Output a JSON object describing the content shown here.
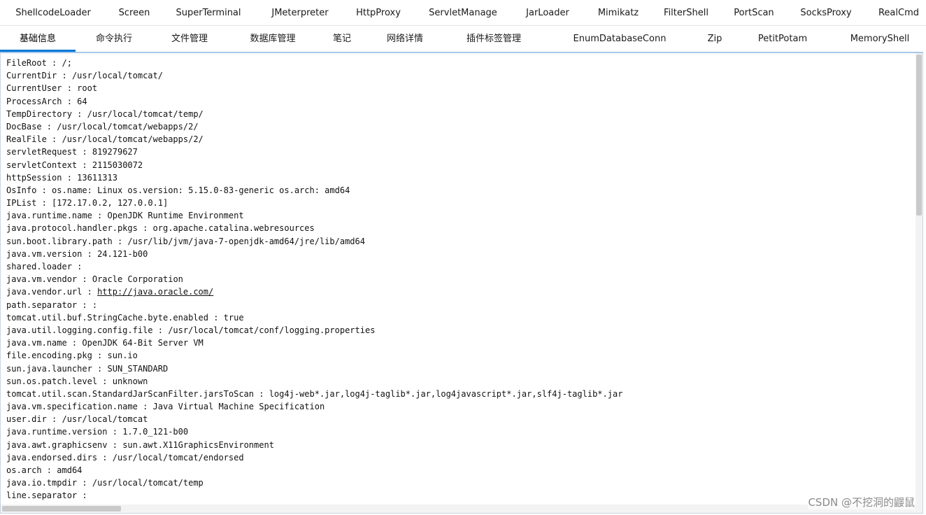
{
  "tabs_row1": [
    {
      "label": "ShellcodeLoader"
    },
    {
      "label": "Screen"
    },
    {
      "label": "SuperTerminal"
    },
    {
      "label": "JMeterpreter"
    },
    {
      "label": "HttpProxy"
    },
    {
      "label": "ServletManage"
    },
    {
      "label": "JarLoader"
    },
    {
      "label": "Mimikatz"
    },
    {
      "label": "FilterShell"
    },
    {
      "label": "PortScan"
    },
    {
      "label": "SocksProxy"
    },
    {
      "label": "RealCmd"
    }
  ],
  "tabs_row2": [
    {
      "label": "基础信息",
      "active": true
    },
    {
      "label": "命令执行"
    },
    {
      "label": "文件管理"
    },
    {
      "label": "数据库管理"
    },
    {
      "label": "笔记"
    },
    {
      "label": "网络详情"
    },
    {
      "label": "插件标签管理"
    },
    {
      "label": "EnumDatabaseConn"
    },
    {
      "label": "Zip"
    },
    {
      "label": "PetitPotam"
    },
    {
      "label": "MemoryShell"
    }
  ],
  "info_lines": [
    {
      "key": "FileRoot",
      "value": "/;"
    },
    {
      "key": "CurrentDir",
      "value": "/usr/local/tomcat/"
    },
    {
      "key": "CurrentUser",
      "value": "root"
    },
    {
      "key": "ProcessArch",
      "value": "64"
    },
    {
      "key": "TempDirectory",
      "value": "/usr/local/tomcat/temp/"
    },
    {
      "key": "DocBase",
      "value": "/usr/local/tomcat/webapps/2/"
    },
    {
      "key": "RealFile",
      "value": "/usr/local/tomcat/webapps/2/"
    },
    {
      "key": "servletRequest",
      "value": "819279627"
    },
    {
      "key": "servletContext",
      "value": "2115030072"
    },
    {
      "key": "httpSession",
      "value": "13611313"
    },
    {
      "key": "OsInfo",
      "value": "os.name: Linux os.version: 5.15.0-83-generic os.arch: amd64"
    },
    {
      "key": "IPList",
      "value": "[172.17.0.2, 127.0.0.1]"
    },
    {
      "key": "java.runtime.name",
      "value": "OpenJDK Runtime Environment"
    },
    {
      "key": "java.protocol.handler.pkgs",
      "value": "org.apache.catalina.webresources"
    },
    {
      "key": "sun.boot.library.path",
      "value": "/usr/lib/jvm/java-7-openjdk-amd64/jre/lib/amd64"
    },
    {
      "key": "java.vm.version",
      "value": "24.121-b00"
    },
    {
      "key": "shared.loader",
      "value": ""
    },
    {
      "key": "java.vm.vendor",
      "value": "Oracle Corporation"
    },
    {
      "key": "java.vendor.url",
      "value": "http://java.oracle.com/",
      "link": true
    },
    {
      "key": "path.separator",
      "value": ":"
    },
    {
      "key": "tomcat.util.buf.StringCache.byte.enabled",
      "value": "true"
    },
    {
      "key": "java.util.logging.config.file",
      "value": "/usr/local/tomcat/conf/logging.properties"
    },
    {
      "key": "java.vm.name",
      "value": "OpenJDK 64-Bit Server VM"
    },
    {
      "key": "file.encoding.pkg",
      "value": "sun.io"
    },
    {
      "key": "sun.java.launcher",
      "value": "SUN_STANDARD"
    },
    {
      "key": "sun.os.patch.level",
      "value": "unknown"
    },
    {
      "key": "tomcat.util.scan.StandardJarScanFilter.jarsToScan",
      "value": "log4j-web*.jar,log4j-taglib*.jar,log4javascript*.jar,slf4j-taglib*.jar"
    },
    {
      "key": "java.vm.specification.name",
      "value": "Java Virtual Machine Specification"
    },
    {
      "key": "user.dir",
      "value": "/usr/local/tomcat"
    },
    {
      "key": "java.runtime.version",
      "value": "1.7.0_121-b00"
    },
    {
      "key": "java.awt.graphicsenv",
      "value": "sun.awt.X11GraphicsEnvironment"
    },
    {
      "key": "java.endorsed.dirs",
      "value": "/usr/local/tomcat/endorsed"
    },
    {
      "key": "os.arch",
      "value": "amd64"
    },
    {
      "key": "java.io.tmpdir",
      "value": "/usr/local/tomcat/temp"
    },
    {
      "key": "line.separator",
      "value": ""
    }
  ],
  "separator": " : ",
  "watermark": "CSDN @不挖洞的鼹鼠",
  "colors": {
    "active_underline": "#0078d7",
    "panel_border": "#a9c7e8"
  }
}
